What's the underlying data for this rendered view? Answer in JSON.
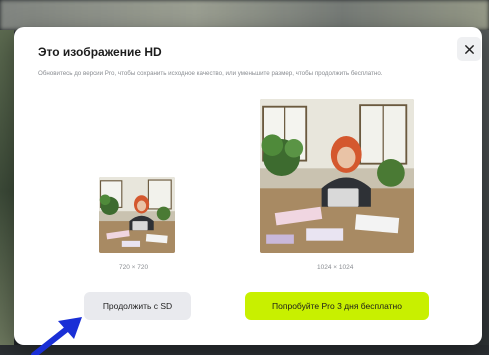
{
  "dialog": {
    "title": "Это изображение HD",
    "subtitle": "Обновитесь до версии Pro, чтобы сохранить исходное качество, или уменьшите размер, чтобы продолжить бесплатно.",
    "close_icon": "close-icon"
  },
  "preview_small": {
    "resolution": "720 × 720"
  },
  "preview_large": {
    "resolution": "1024 × 1024"
  },
  "buttons": {
    "continue_sd": "Продолжить с SD",
    "try_pro": "Попробуйте Pro 3 дня бесплатно"
  },
  "colors": {
    "accent": "#c8f000",
    "secondary_button": "#e9eaee",
    "pointer_arrow": "#1a2fd6"
  }
}
